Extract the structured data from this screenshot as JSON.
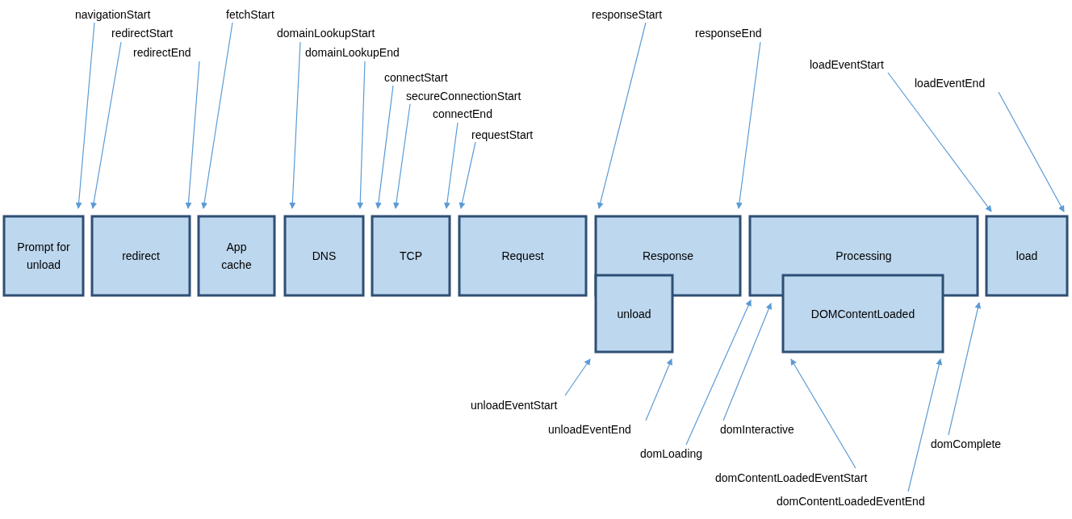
{
  "phases": [
    {
      "lines": [
        "Prompt for",
        "unload"
      ]
    },
    {
      "lines": [
        "redirect"
      ]
    },
    {
      "lines": [
        "App",
        "cache"
      ]
    },
    {
      "lines": [
        "DNS"
      ]
    },
    {
      "lines": [
        "TCP"
      ]
    },
    {
      "lines": [
        "Request"
      ]
    },
    {
      "lines": [
        "Response"
      ]
    },
    {
      "lines": [
        "unload"
      ]
    },
    {
      "lines": [
        "Processing"
      ]
    },
    {
      "lines": [
        "DOMContentLoaded"
      ]
    },
    {
      "lines": [
        "load"
      ]
    }
  ],
  "events": [
    {
      "label": "navigationStart"
    },
    {
      "label": "redirectStart"
    },
    {
      "label": "redirectEnd"
    },
    {
      "label": "fetchStart"
    },
    {
      "label": "domainLookupStart"
    },
    {
      "label": "domainLookupEnd"
    },
    {
      "label": "connectStart"
    },
    {
      "label": "secureConnectionStart"
    },
    {
      "label": "connectEnd"
    },
    {
      "label": "requestStart"
    },
    {
      "label": "responseStart"
    },
    {
      "label": "responseEnd"
    },
    {
      "label": "loadEventStart"
    },
    {
      "label": "loadEventEnd"
    },
    {
      "label": "unloadEventStart"
    },
    {
      "label": "unloadEventEnd"
    },
    {
      "label": "domLoading"
    },
    {
      "label": "domInteractive"
    },
    {
      "label": "domContentLoadedEventStart"
    },
    {
      "label": "domContentLoadedEventEnd"
    },
    {
      "label": "domComplete"
    }
  ]
}
